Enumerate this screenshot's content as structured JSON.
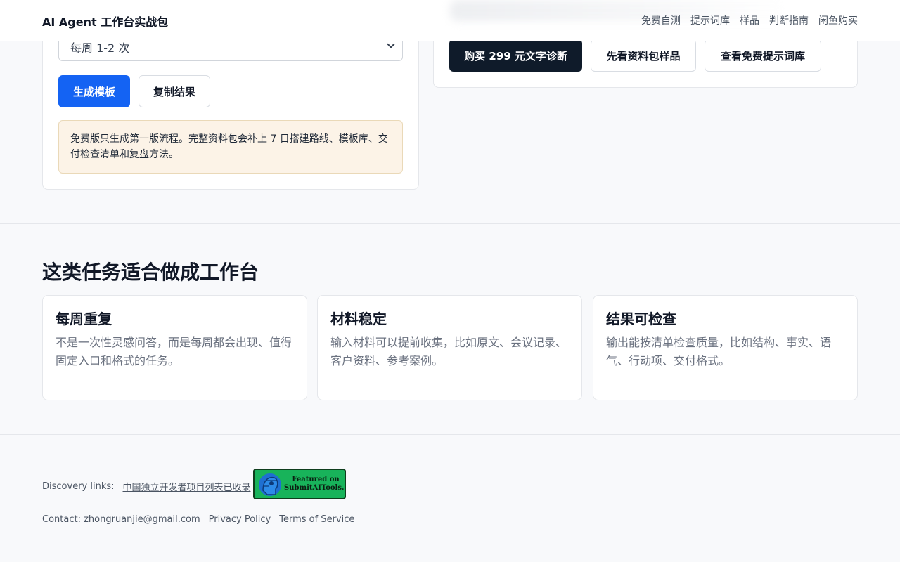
{
  "header": {
    "brand": "AI Agent 工作台实战包",
    "nav": [
      "免费自测",
      "提示词库",
      "样品",
      "判断指南",
      "闲鱼购买"
    ]
  },
  "form": {
    "frequency_value": "每周 1-2 次",
    "generate_label": "生成模板",
    "copy_label": "复制结果",
    "notice": "免费版只生成第一版流程。完整资料包会补上 7 日搭建路线、模板库、交付检查清单和复盘方法。"
  },
  "cta": {
    "buy_label": "购买 299 元文字诊断",
    "sample_label": "先看资料包样品",
    "library_label": "查看免费提示词库"
  },
  "section": {
    "title": "这类任务适合做成工作台",
    "cards": [
      {
        "title": "每周重复",
        "body": "不是一次性灵感问答，而是每周都会出现、值得固定入口和格式的任务。"
      },
      {
        "title": "材料稳定",
        "body": "输入材料可以提前收集，比如原文、会议记录、客户资料、参考案例。"
      },
      {
        "title": "结果可检查",
        "body": "输出能按清单检查质量，比如结构、事实、语气、行动项、交付格式。"
      }
    ]
  },
  "footer": {
    "discovery_label": "Discovery links:",
    "discovery_link": "中国独立开发者项目列表已收录",
    "badge_line1": "Featured on",
    "badge_line2": "SubmitAITools.org",
    "contact": "Contact: zhongruanjie@gmail.com",
    "privacy": "Privacy Policy",
    "terms": "Terms of Service"
  },
  "colors": {
    "primary": "#1463f3",
    "dark_button": "#0f1b2a",
    "notice_bg": "#fcf3e7",
    "badge_green": "#18b35a"
  }
}
